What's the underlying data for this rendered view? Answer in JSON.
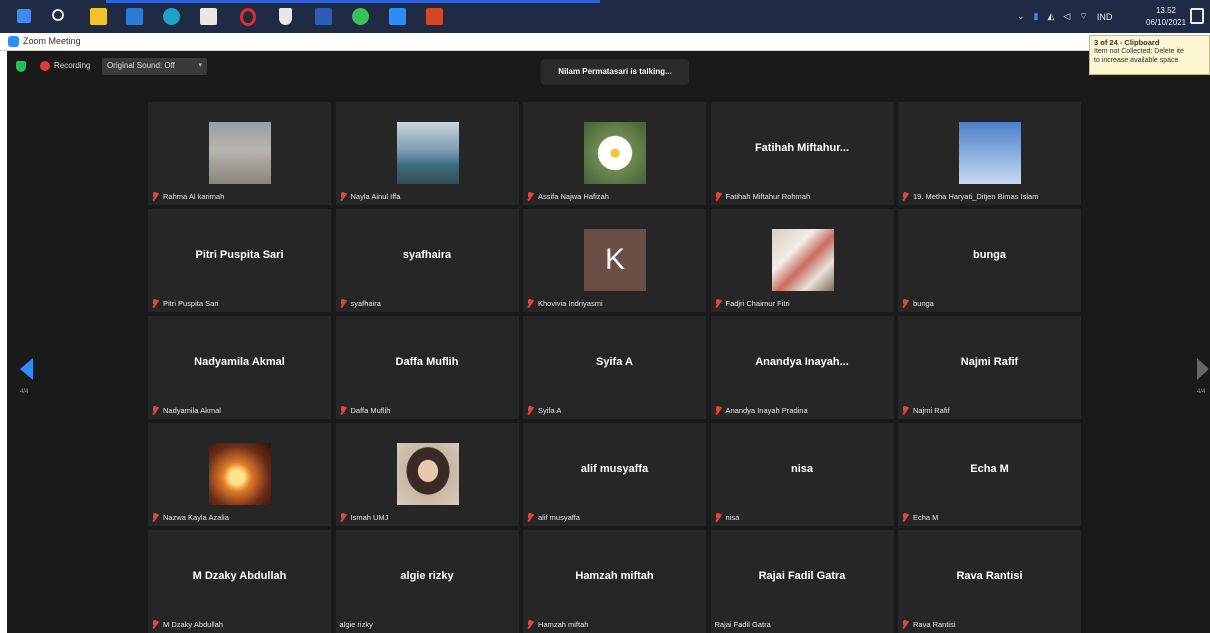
{
  "taskbar": {
    "language": "IND",
    "clock_time": "13.52",
    "clock_date": "06/10/2021"
  },
  "window": {
    "title": "Zoom Meeting"
  },
  "clipboard": {
    "title": "3 of 24 - Clipboard",
    "line1": "Item not Collected: Delete ite",
    "line2": "to increase available space"
  },
  "meeting": {
    "recording_label": "Recording",
    "sound_button": "Original Sound: Off",
    "talking_text": "Nilam Permatasari is talking...",
    "page_left": "4/4",
    "page_right": "4/4"
  },
  "participants": [
    {
      "label": "Rahma Al karimah",
      "avatar": "sky-photo"
    },
    {
      "label": "Nayla Ainul Iffa",
      "avatar": "sea-photo"
    },
    {
      "label": "Assifa Najwa Hafizah",
      "avatar": "flower-photo"
    },
    {
      "big": "Fatihah  Miftahur...",
      "label": "Fatihah Miftahur Rohmah"
    },
    {
      "label": "19. Metha Haryati_Ditjen Bimas Islam",
      "avatar": "blue-sky-photo"
    },
    {
      "big": "Pitri Puspita Sari",
      "label": "Pitri Puspita Sari"
    },
    {
      "big": "syafhaira",
      "label": "syafhaira"
    },
    {
      "label": "Khovivia Indriyasmi",
      "avatar": "letter",
      "letter": "K"
    },
    {
      "label": "Fadjri Chairnur Fitri",
      "avatar": "doll-photo"
    },
    {
      "big": "bunga",
      "label": "bunga"
    },
    {
      "big": "Nadyamila Akmal",
      "label": "Nadyamila Akmal"
    },
    {
      "big": "Daffa Muflih",
      "label": "Daffa Muflih"
    },
    {
      "big": "Syifa A",
      "label": "Syifa A"
    },
    {
      "big": "Anandya  Inayah...",
      "label": "Anandya Inayah Pradina"
    },
    {
      "big": "Najmi Rafif",
      "label": "Najmi Rafif"
    },
    {
      "label": "Nazwa Kayla Azalia",
      "avatar": "lights-photo"
    },
    {
      "label": "Ismah UMJ",
      "avatar": "portrait-photo"
    },
    {
      "big": "alif musyaffa",
      "label": "alif musyaffa"
    },
    {
      "big": "nisa",
      "label": "nisa"
    },
    {
      "big": "Echa M",
      "label": "Echa M"
    },
    {
      "big": "M Dzaky Abdullah",
      "label": "M Dzaky Abdullah"
    },
    {
      "big": "algie rizky",
      "label": "algie rizky",
      "nomic": true
    },
    {
      "big": "Hamzah miftah",
      "label": "Hamzah miftah"
    },
    {
      "big": "Rajai Fadil Gatra",
      "label": "Rajai Fadil Gatra",
      "nomic": true
    },
    {
      "big": "Rava Rantisi",
      "label": "Rava Rantisi"
    }
  ]
}
